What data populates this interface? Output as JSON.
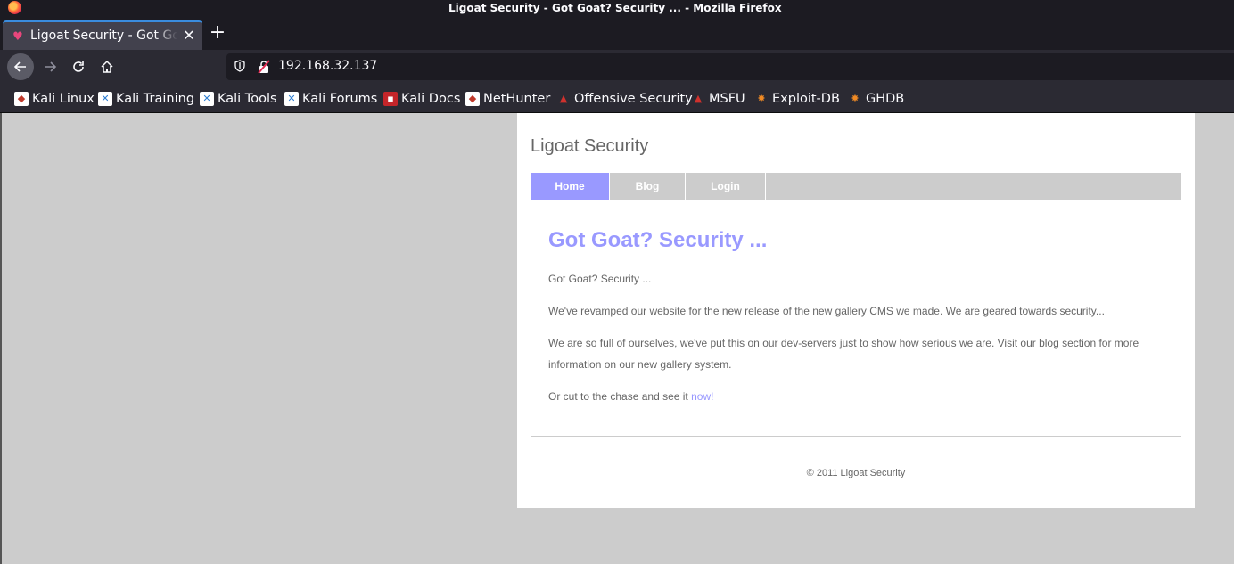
{
  "window": {
    "title": "Ligoat Security - Got Goat? Security ... - Mozilla Firefox"
  },
  "tab": {
    "title": "Ligoat Security - Got Goat? Security ..."
  },
  "urlbar": {
    "url": "192.168.32.137"
  },
  "bookmarks": [
    {
      "label": "Kali Linux",
      "icon": "kali-dragon-icon"
    },
    {
      "label": "Kali Training",
      "icon": "kali-training-icon"
    },
    {
      "label": "Kali Tools",
      "icon": "kali-tools-icon"
    },
    {
      "label": "Kali Forums",
      "icon": "kali-forums-icon"
    },
    {
      "label": "Kali Docs",
      "icon": "kali-docs-icon"
    },
    {
      "label": "NetHunter",
      "icon": "nethunter-icon"
    },
    {
      "label": "Offensive Security",
      "icon": "offsec-icon"
    },
    {
      "label": "MSFU",
      "icon": "msfu-icon"
    },
    {
      "label": "Exploit-DB",
      "icon": "exploitdb-icon"
    },
    {
      "label": "GHDB",
      "icon": "ghdb-icon"
    }
  ],
  "site": {
    "title": "Ligoat Security",
    "menu": [
      "Home",
      "Blog",
      "Login"
    ],
    "post_title": "Got Goat? Security ...",
    "paragraphs": [
      "Got Goat? Security ...",
      "We've revamped our website for the new release of the new gallery CMS we made. We are geared towards security...",
      "We are so full of ourselves, we've put this on our dev-servers just to show how serious we are. Visit our blog section for more information on our new gallery system."
    ],
    "cta_text": "Or cut to the chase and see it ",
    "cta_link": "now!",
    "footer": "© 2011 Ligoat Security"
  },
  "colors": {
    "accent": "#9999ff",
    "menu_bg": "#cccccc",
    "text": "#666666",
    "tab_indicator": "#3a8cde"
  }
}
